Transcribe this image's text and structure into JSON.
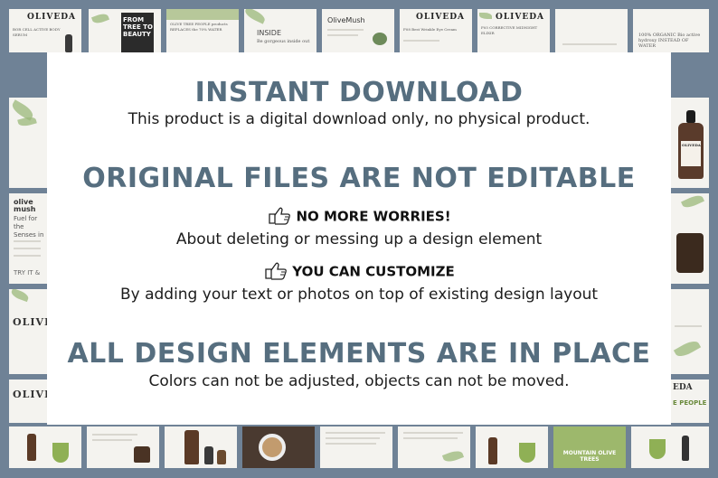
{
  "blocks": {
    "instant": {
      "headline": "INSTANT DOWNLOAD",
      "text": "This product is a digital download only, no physical product."
    },
    "not_editable": {
      "headline": "ORIGINAL FILES ARE NOT EDITABLE",
      "point1_title": "NO MORE WORRIES!",
      "point1_text": "About deleting or messing up a design element",
      "point2_title": "YOU CAN CUSTOMIZE",
      "point2_text": "By adding your text or photos on top of existing design layout"
    },
    "in_place": {
      "headline": "ALL DESIGN ELEMENTS ARE IN PLACE",
      "text": "Colors can not be adjusted, objects can not be moved."
    }
  },
  "thumbnails": {
    "top": [
      {
        "brand": "OLIVEDA",
        "line": "BOR CELL ACTIVE BODY SERUM"
      },
      {
        "brand": "FROM TREE TO BEAUTY"
      },
      {
        "line": "OLIVE TREE PEOPLE products REPLACES the 70% WATER"
      },
      {
        "brand": "INSIDE",
        "line": "Be gorgeous inside out"
      },
      {
        "brand": "OliveMush"
      },
      {
        "brand": "OLIVEDA",
        "line": "F08 Best Wrinkle Eye Cream"
      },
      {
        "brand": "OLIVEDA",
        "line": "F05 CORRECTIVE MIDNIGHT ELIXIR"
      },
      {},
      {
        "line": "100% ORGANIC Bio active hydroxy INSTEAD OF WATER"
      }
    ],
    "left": [
      {},
      {
        "brand": "olive mush",
        "line": "Fuel for the Senses in"
      },
      {
        "line": "TRY IT &"
      },
      {
        "brand": "OLIVEDA"
      },
      {
        "brand": "OLIVEDA"
      }
    ],
    "right": [
      {
        "brand": "OLIVEDA"
      },
      {},
      {
        "brand": "EDA",
        "line": "E PEOPLE"
      }
    ],
    "bottom": [
      {},
      {},
      {},
      {},
      {},
      {},
      {},
      {},
      {
        "line": "MOUNTAIN OLIVE TREES"
      }
    ]
  },
  "colors": {
    "frame": "#6f8296",
    "headline": "#566e7f",
    "panel": "#ffffff",
    "leaf": "#9bb87a"
  }
}
